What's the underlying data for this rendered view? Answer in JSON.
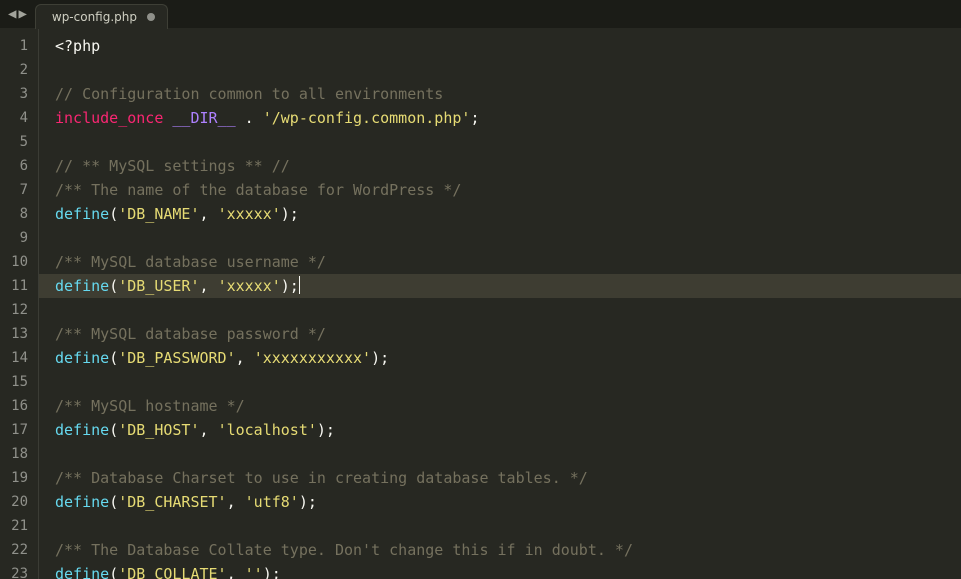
{
  "titlebar": {
    "nav_prev_glyph": "◀",
    "nav_next_glyph": "▶",
    "tab": {
      "label": "wp-config.php",
      "dirty": true
    }
  },
  "editor": {
    "current_line": 11,
    "lines": [
      {
        "n": 1,
        "tokens": [
          {
            "cls": "c-tag",
            "t": "<?php"
          }
        ]
      },
      {
        "n": 2,
        "tokens": []
      },
      {
        "n": 3,
        "tokens": [
          {
            "cls": "c-comment",
            "t": "// Configuration common to all environments"
          }
        ]
      },
      {
        "n": 4,
        "tokens": [
          {
            "cls": "c-keyword",
            "t": "include_once"
          },
          {
            "cls": "",
            "t": " "
          },
          {
            "cls": "c-const",
            "t": "__DIR__"
          },
          {
            "cls": "",
            "t": " "
          },
          {
            "cls": "c-op",
            "t": "."
          },
          {
            "cls": "",
            "t": " "
          },
          {
            "cls": "c-string",
            "t": "'/wp-config.common.php'"
          },
          {
            "cls": "c-punc",
            "t": ";"
          }
        ]
      },
      {
        "n": 5,
        "tokens": []
      },
      {
        "n": 6,
        "tokens": [
          {
            "cls": "c-comment",
            "t": "// ** MySQL settings ** //"
          }
        ]
      },
      {
        "n": 7,
        "tokens": [
          {
            "cls": "c-comment",
            "t": "/** The name of the database for WordPress */"
          }
        ]
      },
      {
        "n": 8,
        "tokens": [
          {
            "cls": "c-func",
            "t": "define"
          },
          {
            "cls": "c-punc",
            "t": "("
          },
          {
            "cls": "c-string",
            "t": "'DB_NAME'"
          },
          {
            "cls": "c-punc",
            "t": ", "
          },
          {
            "cls": "c-string",
            "t": "'xxxxx'"
          },
          {
            "cls": "c-punc",
            "t": ");"
          }
        ]
      },
      {
        "n": 9,
        "tokens": []
      },
      {
        "n": 10,
        "tokens": [
          {
            "cls": "c-comment",
            "t": "/** MySQL database username */"
          }
        ]
      },
      {
        "n": 11,
        "tokens": [
          {
            "cls": "c-func",
            "t": "define"
          },
          {
            "cls": "c-punc",
            "t": "("
          },
          {
            "cls": "c-string",
            "t": "'DB_USER'"
          },
          {
            "cls": "c-punc",
            "t": ", "
          },
          {
            "cls": "c-string",
            "t": "'xxxxx'"
          },
          {
            "cls": "c-punc",
            "t": ");"
          }
        ]
      },
      {
        "n": 12,
        "tokens": []
      },
      {
        "n": 13,
        "tokens": [
          {
            "cls": "c-comment",
            "t": "/** MySQL database password */"
          }
        ]
      },
      {
        "n": 14,
        "tokens": [
          {
            "cls": "c-func",
            "t": "define"
          },
          {
            "cls": "c-punc",
            "t": "("
          },
          {
            "cls": "c-string",
            "t": "'DB_PASSWORD'"
          },
          {
            "cls": "c-punc",
            "t": ", "
          },
          {
            "cls": "c-string",
            "t": "'xxxxxxxxxxx'"
          },
          {
            "cls": "c-punc",
            "t": ");"
          }
        ]
      },
      {
        "n": 15,
        "tokens": []
      },
      {
        "n": 16,
        "tokens": [
          {
            "cls": "c-comment",
            "t": "/** MySQL hostname */"
          }
        ]
      },
      {
        "n": 17,
        "tokens": [
          {
            "cls": "c-func",
            "t": "define"
          },
          {
            "cls": "c-punc",
            "t": "("
          },
          {
            "cls": "c-string",
            "t": "'DB_HOST'"
          },
          {
            "cls": "c-punc",
            "t": ", "
          },
          {
            "cls": "c-string",
            "t": "'localhost'"
          },
          {
            "cls": "c-punc",
            "t": ");"
          }
        ]
      },
      {
        "n": 18,
        "tokens": []
      },
      {
        "n": 19,
        "tokens": [
          {
            "cls": "c-comment",
            "t": "/** Database Charset to use in creating database tables. */"
          }
        ]
      },
      {
        "n": 20,
        "tokens": [
          {
            "cls": "c-func",
            "t": "define"
          },
          {
            "cls": "c-punc",
            "t": "("
          },
          {
            "cls": "c-string",
            "t": "'DB_CHARSET'"
          },
          {
            "cls": "c-punc",
            "t": ", "
          },
          {
            "cls": "c-string",
            "t": "'utf8'"
          },
          {
            "cls": "c-punc",
            "t": ");"
          }
        ]
      },
      {
        "n": 21,
        "tokens": []
      },
      {
        "n": 22,
        "tokens": [
          {
            "cls": "c-comment",
            "t": "/** The Database Collate type. Don't change this if in doubt. */"
          }
        ]
      },
      {
        "n": 23,
        "tokens": [
          {
            "cls": "c-func",
            "t": "define"
          },
          {
            "cls": "c-punc",
            "t": "("
          },
          {
            "cls": "c-string",
            "t": "'DB_COLLATE'"
          },
          {
            "cls": "c-punc",
            "t": ", "
          },
          {
            "cls": "c-string",
            "t": "''"
          },
          {
            "cls": "c-punc",
            "t": ");"
          }
        ]
      }
    ]
  }
}
